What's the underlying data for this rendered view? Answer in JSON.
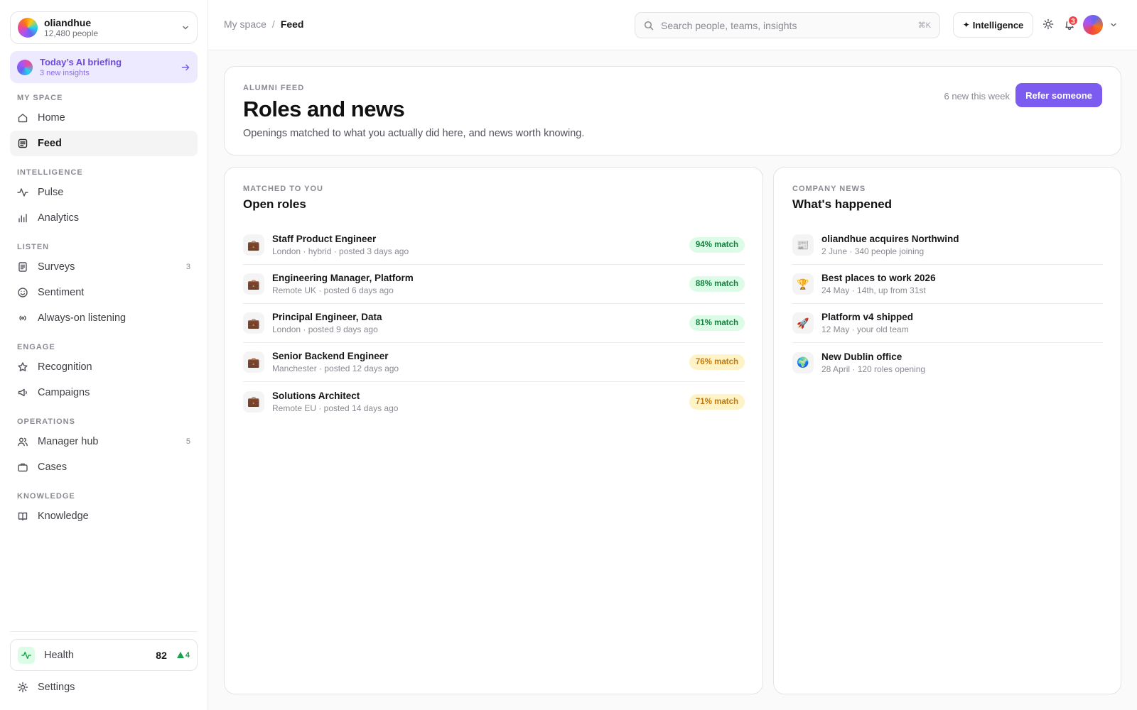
{
  "org": {
    "name": "oliandhue",
    "people": "12,480 people"
  },
  "briefing": {
    "title": "Today’s AI briefing",
    "subtitle": "3 new insights"
  },
  "nav": {
    "sections": [
      {
        "label": "MY SPACE",
        "items": [
          {
            "label": "Home",
            "icon": "home-icon"
          },
          {
            "label": "Feed",
            "icon": "feed-icon",
            "active": true
          }
        ]
      },
      {
        "label": "INTELLIGENCE",
        "items": [
          {
            "label": "Pulse",
            "icon": "pulse-icon"
          },
          {
            "label": "Analytics",
            "icon": "bar-chart-icon"
          }
        ]
      },
      {
        "label": "LISTEN",
        "items": [
          {
            "label": "Surveys",
            "icon": "clipboard-icon",
            "count": "3"
          },
          {
            "label": "Sentiment",
            "icon": "smile-icon"
          },
          {
            "label": "Always-on listening",
            "icon": "broadcast-icon"
          }
        ]
      },
      {
        "label": "ENGAGE",
        "items": [
          {
            "label": "Recognition",
            "icon": "star-icon"
          },
          {
            "label": "Campaigns",
            "icon": "megaphone-icon"
          }
        ]
      },
      {
        "label": "OPERATIONS",
        "items": [
          {
            "label": "Manager hub",
            "icon": "users-icon",
            "count": "5"
          },
          {
            "label": "Cases",
            "icon": "briefcase-icon"
          }
        ]
      },
      {
        "label": "KNOWLEDGE",
        "items": [
          {
            "label": "Knowledge",
            "icon": "book-icon"
          }
        ]
      }
    ]
  },
  "health": {
    "label": "Health",
    "score": "82",
    "delta": "4"
  },
  "settings": {
    "label": "Settings"
  },
  "topbar": {
    "breadcrumb_parent": "My space",
    "breadcrumb_sep": "/",
    "breadcrumb_current": "Feed",
    "search_placeholder": "Search people, teams, insights",
    "search_shortcut": "⌘K",
    "intelligence_label": "Intelligence",
    "notifications_count": "3"
  },
  "header": {
    "eyebrow": "ALUMNI FEED",
    "title": "Roles and news",
    "subtitle": "Openings matched to what you actually did here, and news worth knowing.",
    "new_this_week": "6 new this week",
    "refer_label": "Refer someone"
  },
  "roles": {
    "eyebrow": "MATCHED TO YOU",
    "title": "Open roles",
    "items": [
      {
        "title": "Staff Product Engineer",
        "meta": "London · hybrid · posted 3 days ago",
        "match": "94% match",
        "level": "high",
        "icon": "💼"
      },
      {
        "title": "Engineering Manager, Platform",
        "meta": "Remote UK · posted 6 days ago",
        "match": "88% match",
        "level": "high",
        "icon": "💼"
      },
      {
        "title": "Principal Engineer, Data",
        "meta": "London · posted 9 days ago",
        "match": "81% match",
        "level": "high",
        "icon": "💼"
      },
      {
        "title": "Senior Backend Engineer",
        "meta": "Manchester · posted 12 days ago",
        "match": "76% match",
        "level": "mid",
        "icon": "💼"
      },
      {
        "title": "Solutions Architect",
        "meta": "Remote EU · posted 14 days ago",
        "match": "71% match",
        "level": "mid",
        "icon": "💼"
      }
    ]
  },
  "news": {
    "eyebrow": "COMPANY NEWS",
    "title": "What's happened",
    "items": [
      {
        "title": "oliandhue acquires Northwind",
        "meta": "2 June · 340 people joining",
        "icon": "📰"
      },
      {
        "title": "Best places to work 2026",
        "meta": "24 May · 14th, up from 31st",
        "icon": "🏆"
      },
      {
        "title": "Platform v4 shipped",
        "meta": "12 May · your old team",
        "icon": "🚀"
      },
      {
        "title": "New Dublin office",
        "meta": "28 April · 120 roles opening",
        "icon": "🌍"
      }
    ]
  },
  "colors": {
    "accent": "#7c5cf0",
    "match_high": "#15803d",
    "match_mid": "#c2780a",
    "alert": "#ef4444"
  }
}
